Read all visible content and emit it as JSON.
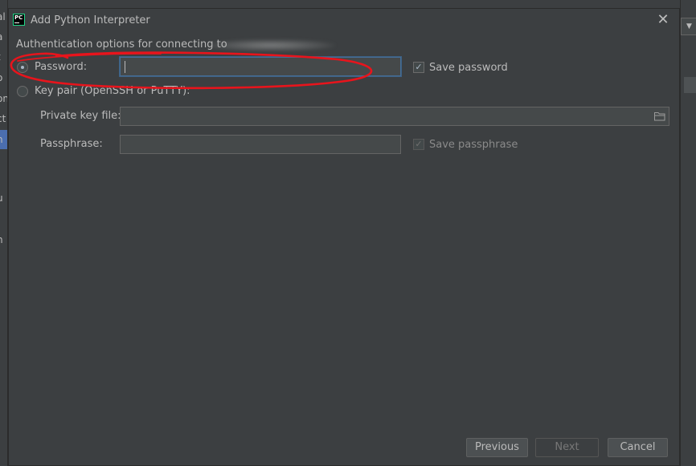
{
  "background": {
    "left_fragments": [
      "al",
      "a",
      "t",
      "o",
      "on",
      "ct",
      "h",
      "j",
      "l",
      "u",
      "n"
    ],
    "right_dropdown_glyph": "▼"
  },
  "dialog": {
    "app_icon_text": "PC",
    "title": "Add Python Interpreter",
    "close_glyph": "✕",
    "auth_label": "Authentication options for connecting to"
  },
  "options": {
    "password": {
      "label": "Password:",
      "selected": true,
      "value": "",
      "save_checkbox": {
        "label": "Save password",
        "checked": true,
        "check_glyph": "✓"
      }
    },
    "keypair": {
      "label": "Key pair (OpenSSH or PuTTY):",
      "selected": false,
      "private_key_label": "Private key file:",
      "private_key_value": "",
      "passphrase_label": "Passphrase:",
      "passphrase_value": "",
      "save_checkbox": {
        "label": "Save passphrase",
        "checked": true,
        "disabled": true,
        "check_glyph": "✓"
      }
    }
  },
  "buttons": {
    "previous": "Previous",
    "next": "Next",
    "cancel": "Cancel"
  },
  "colors": {
    "annotation": "#e8141c",
    "focus_border": "#466d94",
    "app_icon_accent": "#21d789",
    "selection": "#4b6eaf"
  }
}
